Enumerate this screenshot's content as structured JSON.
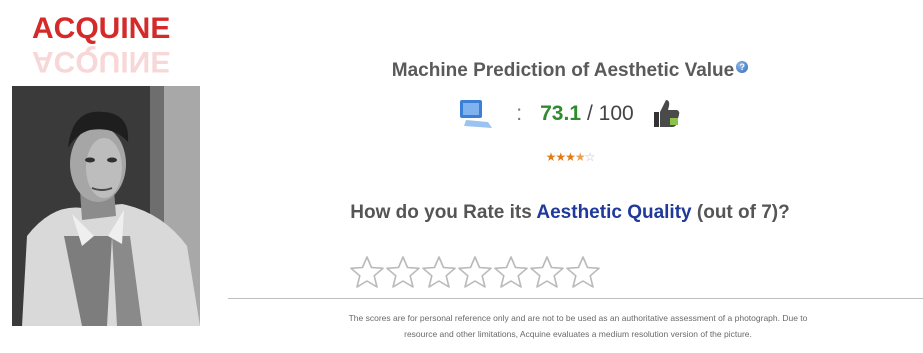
{
  "logo": {
    "text": "ACQUINE"
  },
  "photo": {
    "alt": "Black and white portrait photograph"
  },
  "heading": {
    "text": "Machine Prediction of Aesthetic Value",
    "help_icon": "question-mark"
  },
  "score": {
    "separator": ":",
    "value": "73.1",
    "max": "/ 100",
    "icons": [
      "monitor-icon",
      "thumbs-up-icon"
    ]
  },
  "machine_stars": {
    "rating": 3.5,
    "out_of": 5,
    "filled": "★★★",
    "half": "★",
    "empty": "☆"
  },
  "question": {
    "prefix": "How do you Rate its ",
    "highlight": "Aesthetic Quality",
    "suffix": " (out of 7)?"
  },
  "user_rating": {
    "count": 7,
    "selected": 0
  },
  "disclaimer": {
    "line1": "The scores are for personal reference only and are not to be used as an authoritative assessment of a photograph. Due to",
    "line2": "resource and other limitations, Acquine evaluates a medium resolution version of the picture."
  },
  "colors": {
    "logo": "#d42a2a",
    "score": "#2e8b2e",
    "highlight": "#1f3a9a",
    "stars": "#e07b18"
  }
}
